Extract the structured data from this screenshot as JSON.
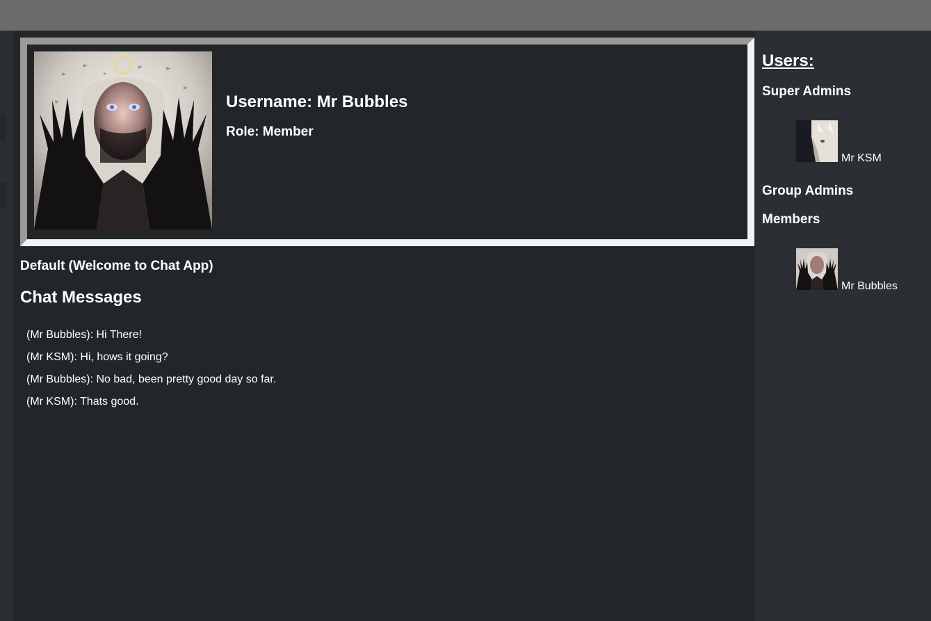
{
  "profile": {
    "username": "Username: Mr Bubbles",
    "role": "Role: Member",
    "avatar_icon": "user-avatar-large"
  },
  "channel": {
    "name": "Default (Welcome to Chat App)"
  },
  "chat": {
    "heading": "Chat Messages",
    "messages": [
      "(Mr Bubbles): Hi There!",
      "(Mr KSM): Hi, hows it going?",
      "(Mr Bubbles): No bad, been pretty good day so far.",
      "(Mr KSM): Thats good."
    ]
  },
  "users": {
    "title": "Users:",
    "super_admins": {
      "label": "Super Admins",
      "members": [
        "Mr KSM"
      ]
    },
    "group_admins": {
      "label": "Group Admins"
    },
    "members": {
      "label": "Members",
      "members": [
        "Mr Bubbles"
      ]
    }
  },
  "colors": {
    "topbar": "#6b6b6b",
    "main_background": "#232629",
    "side_background": "#2b2e32",
    "text": "#ffffff"
  }
}
